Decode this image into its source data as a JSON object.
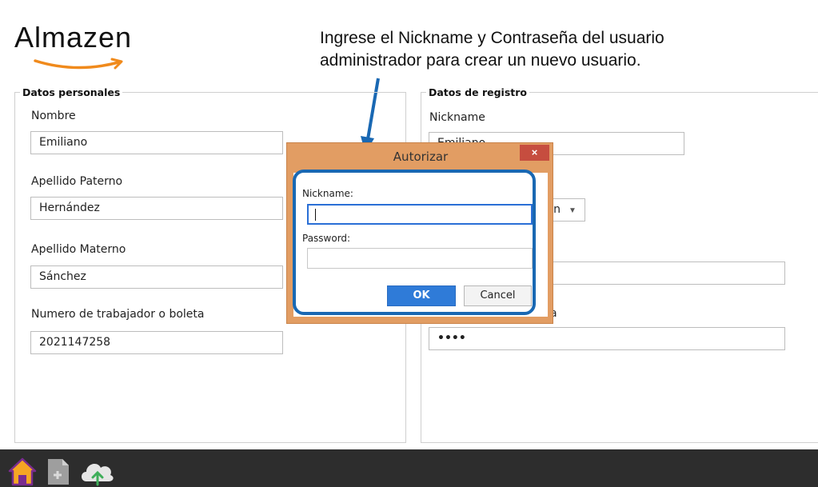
{
  "logo": {
    "text": "Almazen"
  },
  "annotation": {
    "line1": "Ingrese el Nickname y Contraseña del usuario",
    "line2": "administrador para crear un nuevo usuario."
  },
  "personal": {
    "legend": "Datos personales",
    "nombre_label": "Nombre",
    "nombre_value": "Emiliano",
    "apellido_paterno_label": "Apellido Paterno",
    "apellido_paterno_value": "Hernández",
    "apellido_materno_label": "Apellido Materno",
    "apellido_materno_value": "Sánchez",
    "numero_label": "Numero de trabajador o boleta",
    "numero_value": "2021147258"
  },
  "registro": {
    "legend": "Datos de registro",
    "nickname_label": "Nickname",
    "nickname_value": "Emiliano",
    "combo_value": "cén",
    "password_label_partial": "a",
    "password_value": "••••"
  },
  "dialog": {
    "title": "Autorizar",
    "close_symbol": "×",
    "nickname_label": "Nickname:",
    "nickname_value": "",
    "password_label": "Password:",
    "password_value": "",
    "ok_label": "OK",
    "cancel_label": "Cancel"
  },
  "taskbar": {
    "icons": [
      "home-icon",
      "new-document-icon",
      "cloud-upload-icon"
    ]
  },
  "colors": {
    "dialog_frame": "#e29d63",
    "close_button": "#c64d3f",
    "ok_button": "#2f7bd8",
    "highlight": "#1968b3",
    "taskbar": "#2d2d2d"
  }
}
